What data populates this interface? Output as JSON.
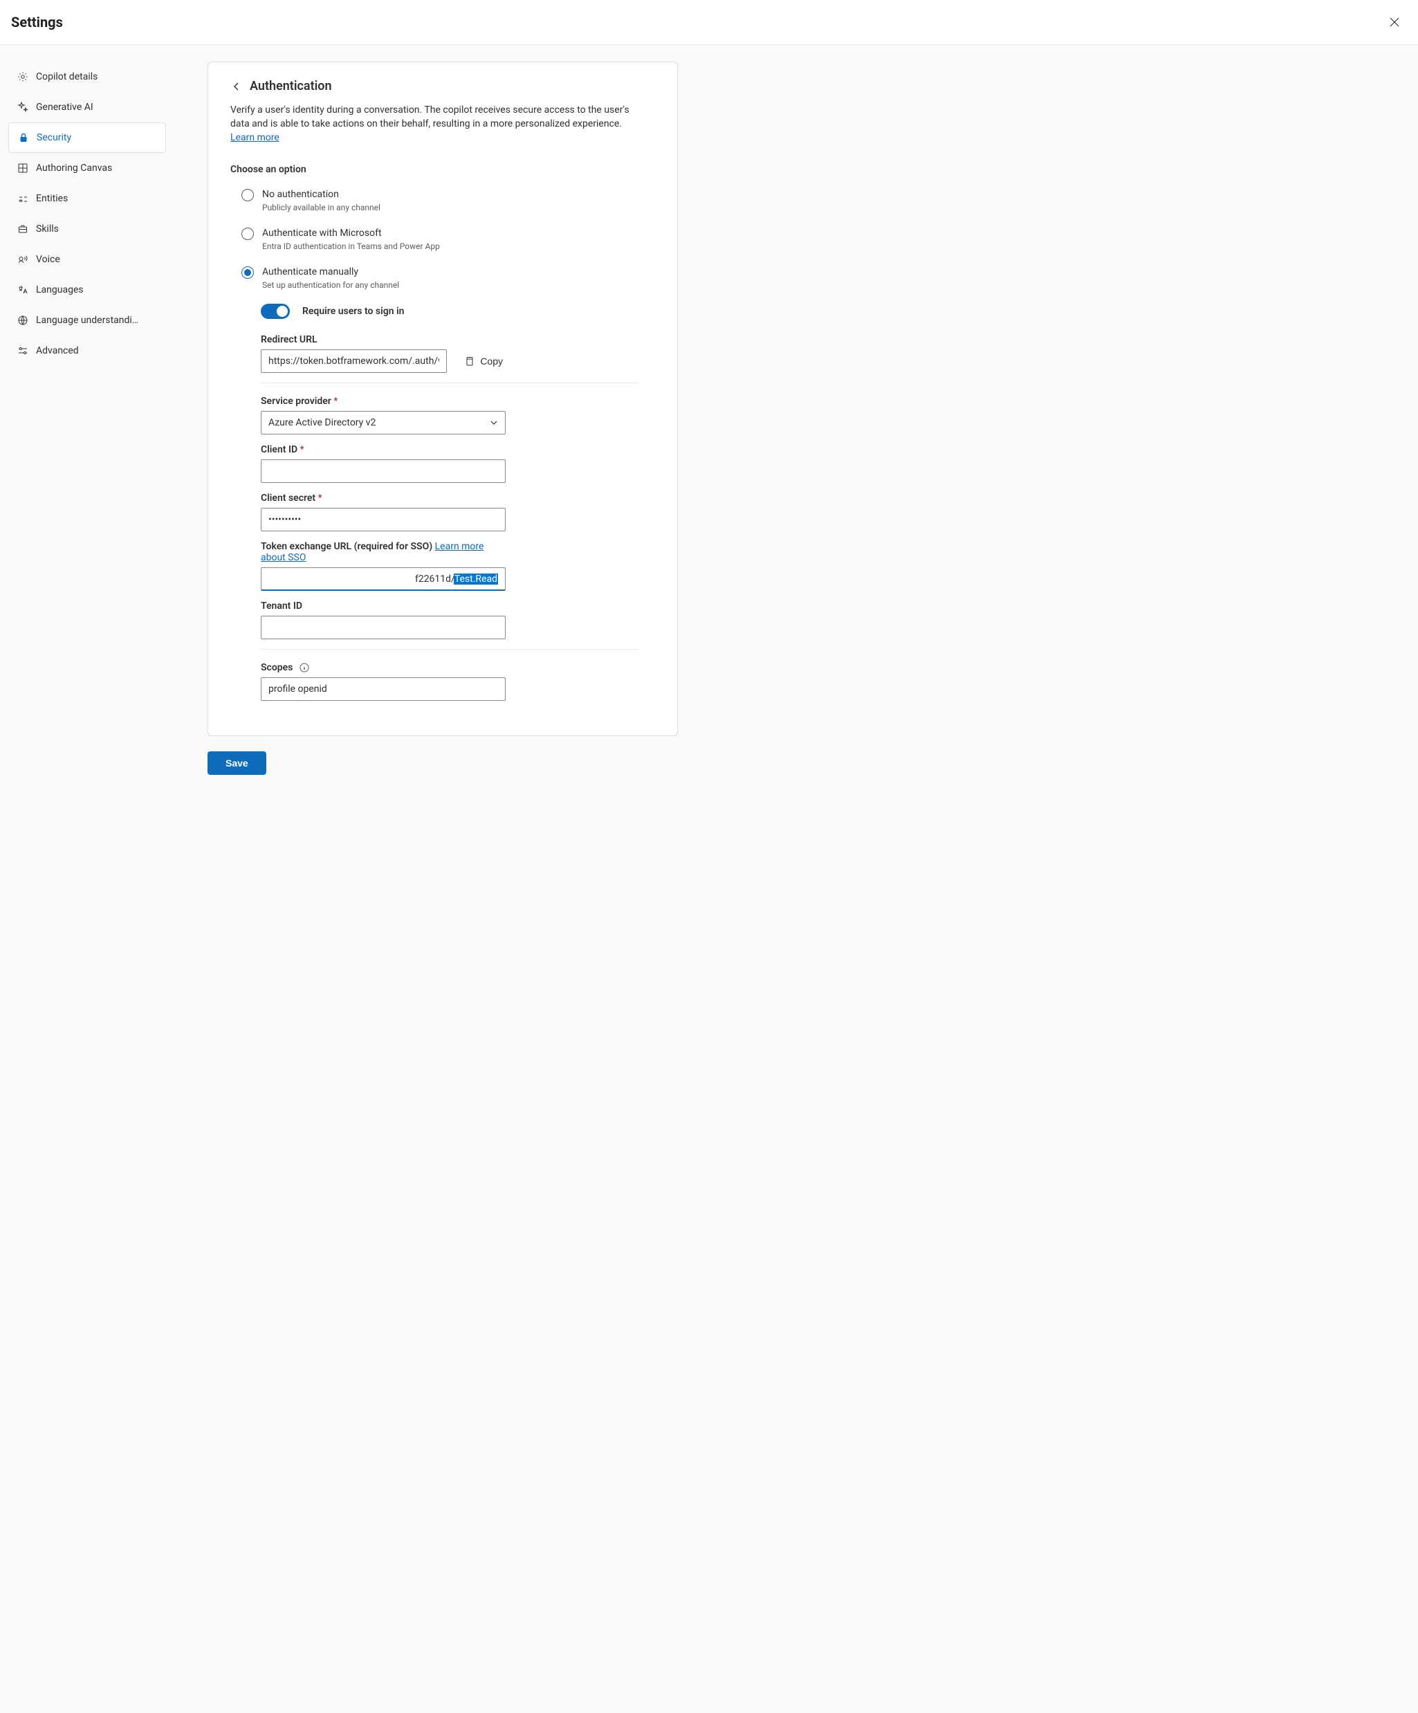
{
  "header": {
    "title": "Settings"
  },
  "sidebar": {
    "items": [
      {
        "id": "copilot-details",
        "label": "Copilot details"
      },
      {
        "id": "generative-ai",
        "label": "Generative AI"
      },
      {
        "id": "security",
        "label": "Security"
      },
      {
        "id": "authoring-canvas",
        "label": "Authoring Canvas"
      },
      {
        "id": "entities",
        "label": "Entities"
      },
      {
        "id": "skills",
        "label": "Skills"
      },
      {
        "id": "voice",
        "label": "Voice"
      },
      {
        "id": "languages",
        "label": "Languages"
      },
      {
        "id": "language-understanding",
        "label": "Language understandi…"
      },
      {
        "id": "advanced",
        "label": "Advanced"
      }
    ],
    "active_index": 2
  },
  "page": {
    "title": "Authentication",
    "description_prefix": "Verify a user's identity during a conversation. The copilot receives secure access to the user's data and is able to take actions on their behalf, resulting in a more personalized experience. ",
    "learn_more": "Learn more",
    "choose_label": "Choose an option",
    "options": [
      {
        "title": "No authentication",
        "sub": "Publicly available in any channel"
      },
      {
        "title": "Authenticate with Microsoft",
        "sub": "Entra ID authentication in Teams and Power App"
      },
      {
        "title": "Authenticate manually",
        "sub": "Set up authentication for any channel"
      }
    ],
    "selected_option_index": 2,
    "toggle": {
      "label": "Require users to sign in",
      "on": true
    },
    "redirect": {
      "label": "Redirect URL",
      "value": "https://token.botframework.com/.auth/web/re",
      "copy": "Copy"
    },
    "provider": {
      "label": "Service provider",
      "value": "Azure Active Directory v2"
    },
    "client_id": {
      "label": "Client ID",
      "value": ""
    },
    "client_secret": {
      "label": "Client secret",
      "value": "••••••••••"
    },
    "token_exchange": {
      "label_prefix": "Token exchange URL (required for SSO) ",
      "link": "Learn more about SSO",
      "display": "f22611d/Test.Read",
      "selected_fragment": "Test.Read"
    },
    "tenant_id": {
      "label": "Tenant ID",
      "value": ""
    },
    "scopes": {
      "label": "Scopes",
      "value": "profile openid"
    },
    "save": "Save"
  }
}
